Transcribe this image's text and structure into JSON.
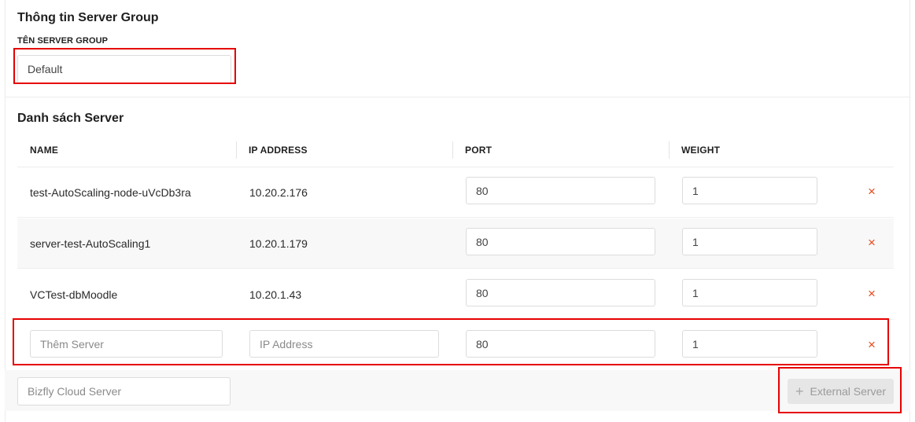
{
  "group": {
    "title": "Thông tin Server Group",
    "name_label": "TÊN SERVER GROUP",
    "name_value": "Default"
  },
  "servers": {
    "title": "Danh sách Server",
    "columns": [
      "NAME",
      "IP ADDRESS",
      "PORT",
      "WEIGHT"
    ],
    "rows": [
      {
        "name": "test-AutoScaling-node-uVcDb3ra",
        "ip": "10.20.2.176",
        "port": "80",
        "weight": "1"
      },
      {
        "name": "server-test-AutoScaling1",
        "ip": "10.20.1.179",
        "port": "80",
        "weight": "1"
      },
      {
        "name": "VCTest-dbMoodle",
        "ip": "10.20.1.43",
        "port": "80",
        "weight": "1"
      }
    ],
    "new_row": {
      "name_placeholder": "Thêm Server",
      "ip_placeholder": "IP Address",
      "port": "80",
      "weight": "1"
    },
    "delete_icon": "×"
  },
  "footer": {
    "cloud_server_placeholder": "Bizfly Cloud Server",
    "external_button": "External Server",
    "plus_icon": "+"
  },
  "colors": {
    "delete": "#e8491d",
    "highlight": "#e60000"
  }
}
